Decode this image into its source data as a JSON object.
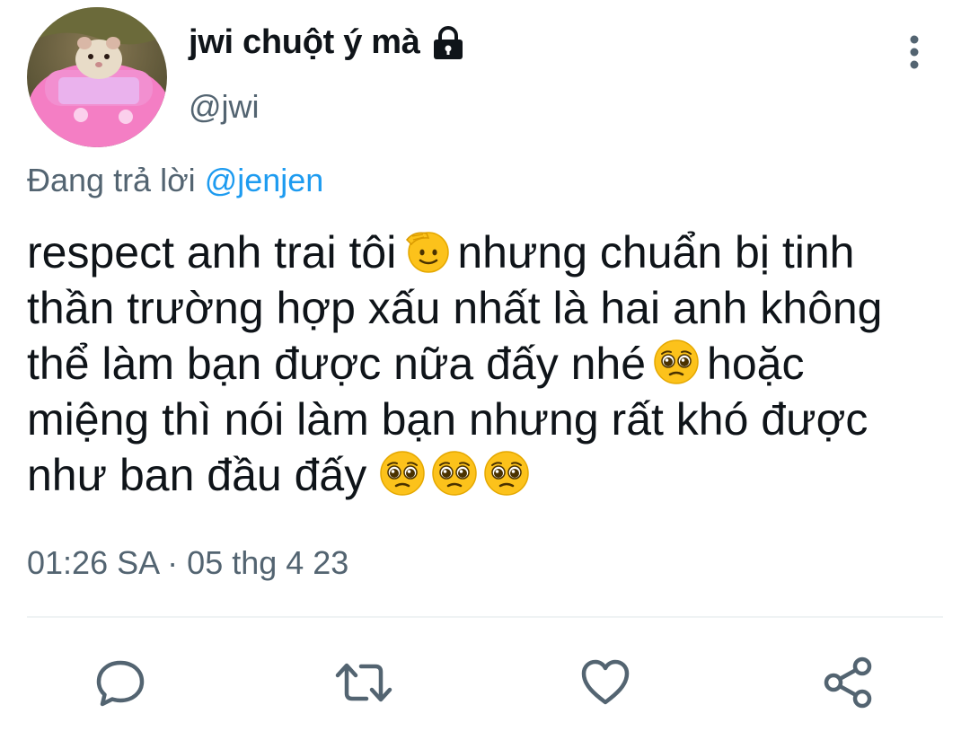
{
  "tweet": {
    "display_name": "jwi chuột ý mà",
    "handle": "@jwi",
    "reply_prefix": "Đang trả lời",
    "reply_to": "@jenjen",
    "text_lines": [
      [
        "respect anh trai tôi",
        "saluting-face-emoji",
        "nhưng chuẩn bị tinh"
      ],
      [
        "thần trường hợp xấu nhất là hai anh không"
      ],
      [
        "thể làm bạn được nữa đấy nhé",
        "pleading-face-emoji",
        "hoặc"
      ],
      [
        "miệng thì nói làm bạn nhưng rất khó được"
      ],
      [
        "như ban đầu đấy",
        "pleading-face-emoji",
        "pleading-face-emoji",
        "pleading-face-emoji"
      ]
    ],
    "line1_a": "respect anh trai tôi",
    "line1_b": "nhưng chuẩn bị tinh",
    "line2": "thần trường hợp xấu nhất là hai anh không",
    "line3_a": "thể làm bạn được nữa đấy nhé",
    "line3_b": "hoặc",
    "line4": "miệng thì nói làm bạn nhưng rất khó được",
    "line5": "như ban đầu đấy",
    "time": "01:26 SA",
    "separator": "·",
    "date": "05 thg 4 23",
    "icons": {
      "lock": "lock-icon",
      "more": "more-vertical-icon",
      "reply": "reply-icon",
      "retweet": "retweet-icon",
      "like": "heart-icon",
      "share": "share-icon"
    }
  },
  "colors": {
    "text": "#0f1419",
    "secondary": "#536471",
    "link": "#1d9bf0",
    "divider": "#eff3f4",
    "emoji_yellow": "#fcc21b"
  }
}
